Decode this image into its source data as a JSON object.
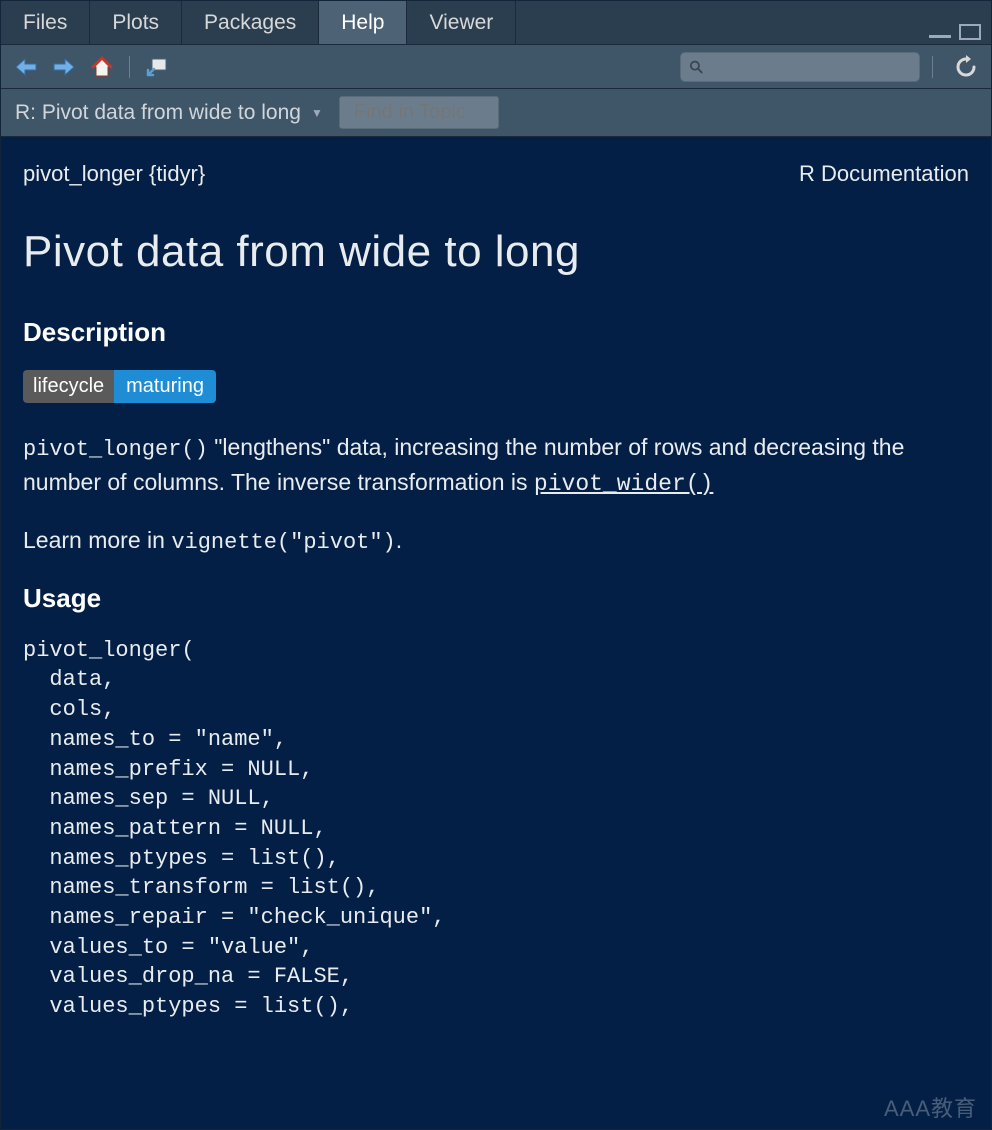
{
  "tabs": {
    "items": [
      "Files",
      "Plots",
      "Packages",
      "Help",
      "Viewer"
    ],
    "active_index": 3
  },
  "toolbar": {
    "search_placeholder": ""
  },
  "breadcrumb": {
    "label": "R: Pivot data from wide to long",
    "find_placeholder": "Find in Topic"
  },
  "doc": {
    "topic": "pivot_longer {tidyr}",
    "docset": "R Documentation",
    "title": "Pivot data from wide to long",
    "sections": {
      "description": "Description",
      "usage": "Usage"
    },
    "badge": {
      "left": "lifecycle",
      "right": "maturing"
    },
    "desc_code1": "pivot_longer()",
    "desc_text1": " \"lengthens\" data, increasing the number of rows and decreasing the number of columns. The inverse transformation is ",
    "desc_link": "pivot_wider()",
    "desc_text2": "Learn more in ",
    "desc_code2": "vignette(\"pivot\")",
    "desc_text3": ".",
    "usage_code": "pivot_longer(\n  data,\n  cols,\n  names_to = \"name\",\n  names_prefix = NULL,\n  names_sep = NULL,\n  names_pattern = NULL,\n  names_ptypes = list(),\n  names_transform = list(),\n  names_repair = \"check_unique\",\n  values_to = \"value\",\n  values_drop_na = FALSE,\n  values_ptypes = list(),"
  },
  "watermark": "AAA教育"
}
